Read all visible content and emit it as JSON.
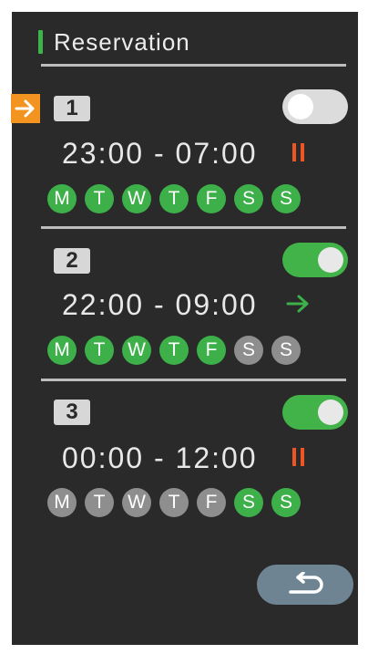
{
  "header": {
    "title": "Reservation"
  },
  "colors": {
    "accent_green": "#3cb44a",
    "marker_orange": "#f2941f",
    "pause_red": "#ee5522",
    "inactive_day": "#8e8e8e",
    "background": "#2a2a2a"
  },
  "slots": [
    {
      "number": "1",
      "enabled": false,
      "selected": true,
      "time": "23:00 - 07:00",
      "status_icon": "pause-icon",
      "days": [
        {
          "label": "M",
          "active": true
        },
        {
          "label": "T",
          "active": true
        },
        {
          "label": "W",
          "active": true
        },
        {
          "label": "T",
          "active": true
        },
        {
          "label": "F",
          "active": true
        },
        {
          "label": "S",
          "active": true
        },
        {
          "label": "S",
          "active": true
        }
      ]
    },
    {
      "number": "2",
      "enabled": true,
      "selected": false,
      "time": "22:00 - 09:00",
      "status_icon": "arrow-right-icon",
      "days": [
        {
          "label": "M",
          "active": true
        },
        {
          "label": "T",
          "active": true
        },
        {
          "label": "W",
          "active": true
        },
        {
          "label": "T",
          "active": true
        },
        {
          "label": "F",
          "active": true
        },
        {
          "label": "S",
          "active": false
        },
        {
          "label": "S",
          "active": false
        }
      ]
    },
    {
      "number": "3",
      "enabled": true,
      "selected": false,
      "time": "00:00 - 12:00",
      "status_icon": "pause-icon",
      "days": [
        {
          "label": "M",
          "active": false
        },
        {
          "label": "T",
          "active": false
        },
        {
          "label": "W",
          "active": false
        },
        {
          "label": "T",
          "active": false
        },
        {
          "label": "F",
          "active": false
        },
        {
          "label": "S",
          "active": true
        },
        {
          "label": "S",
          "active": true
        }
      ]
    }
  ],
  "back_button": {
    "icon": "return-icon"
  }
}
